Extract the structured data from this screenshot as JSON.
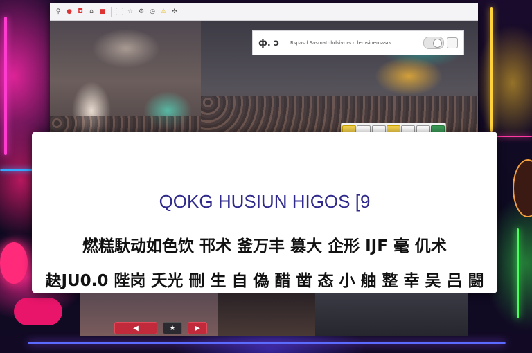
{
  "browser": {
    "tab_icons": [
      "pin-icon",
      "record-icon",
      "bookmark-icon",
      "home-icon",
      "stop-icon",
      "star-icon",
      "settings-icon",
      "history-icon",
      "extension-icon",
      "alert-icon"
    ],
    "page_panel": {
      "logo": "ф. ↄ",
      "text": "Rspasd Sasmatnhdsivnrs rclemsinensssrs"
    },
    "pill_bar": {
      "states": [
        "on",
        "off",
        "off",
        "on",
        "off",
        "off",
        "green"
      ]
    }
  },
  "caption": {
    "title": "QOKG HUSIUN HIGOS [9",
    "line1": "燃糕馱动如色饮 邗术 釜万丰 篡大 企形 IJF 毫 仉术",
    "line2": "赽JU0.0 陛岗 夭光 刪 生 自 偽 醋 凿 态 小 舳 整 幸 吴 吕 闘"
  },
  "dock": {
    "buttons": [
      "◀",
      "★",
      "▶"
    ]
  },
  "colors": {
    "caption_title": "#2f2a8c",
    "neon_pink": "#ff3bd0",
    "neon_green": "#46ff5a",
    "neon_yellow": "#ffd23a"
  }
}
